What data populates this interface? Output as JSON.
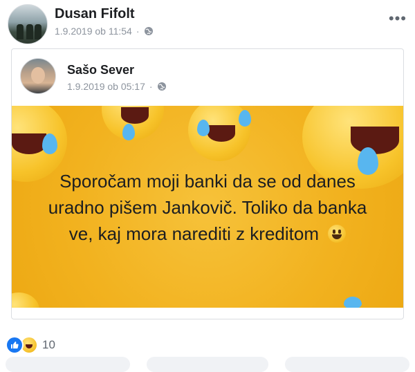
{
  "post": {
    "author": "Dusan Fifolt",
    "timestamp": "1.9.2019 ob 11:54",
    "privacy_icon": "globe-icon",
    "more_label": "•••"
  },
  "shared": {
    "author": "Sašo Sever",
    "timestamp": "1.9.2019 ob 05:17",
    "privacy_icon": "globe-icon",
    "text_lines": [
      "Sporočam moji banki da se od danes",
      "uradno pišem Jankovič. Toliko da banka",
      "ve, kaj mora narediti z kreditom"
    ],
    "background_color": "#f2b21f"
  },
  "reactions": {
    "icons": [
      "like-icon",
      "haha-icon"
    ],
    "count": "10"
  }
}
